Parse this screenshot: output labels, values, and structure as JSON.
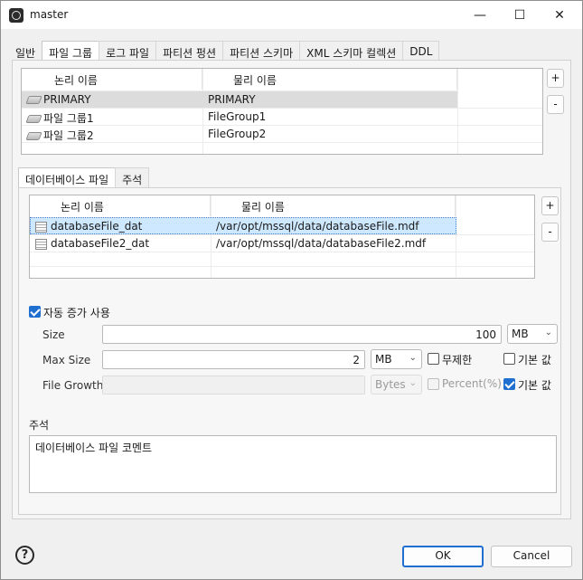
{
  "window": {
    "title": "master",
    "controls": {
      "minimize": "—",
      "maximize": "☐",
      "close": "✕"
    }
  },
  "tabs": [
    "일반",
    "파일 그룹",
    "로그 파일",
    "파티션 펑션",
    "파티션 스키마",
    "XML 스키마 컬렉션",
    "DDL"
  ],
  "active_tab": "파일 그룹",
  "filegroups": {
    "columns": [
      "논리 이름",
      "물리 이름"
    ],
    "rows": [
      {
        "logical": "PRIMARY",
        "physical": "PRIMARY",
        "selected": true
      },
      {
        "logical": "파일 그룹1",
        "physical": "FileGroup1",
        "selected": false
      },
      {
        "logical": "파일 그룹2",
        "physical": "FileGroup2",
        "selected": false
      }
    ],
    "add_label": "+",
    "remove_label": "-"
  },
  "subtabs": [
    "데이터베이스 파일",
    "주석"
  ],
  "active_subtab": "데이터베이스 파일",
  "dbfiles": {
    "columns": [
      "논리 이름",
      "물리 이름"
    ],
    "rows": [
      {
        "logical": "databaseFile_dat",
        "physical": "/var/opt/mssql/data/databaseFile.mdf",
        "selected": true
      },
      {
        "logical": "databaseFile2_dat",
        "physical": "/var/opt/mssql/data/databaseFile2.mdf",
        "selected": false
      }
    ],
    "add_label": "+",
    "remove_label": "-"
  },
  "autogrow": {
    "label": "자동 증가 사용",
    "checked": true,
    "size_label": "Size",
    "size_value": "100",
    "size_unit": "MB",
    "maxsize_label": "Max Size",
    "maxsize_value": "2",
    "maxsize_unit": "MB",
    "unlimited_label": "무제한",
    "unlimited_checked": false,
    "maxsize_default_label": "기본 값",
    "maxsize_default_checked": false,
    "filegrowth_label": "File Growth",
    "filegrowth_value": "",
    "filegrowth_unit": "Bytes",
    "percent_label": "Percent(%)",
    "percent_checked": false,
    "growth_default_label": "기본 값",
    "growth_default_checked": true
  },
  "comment": {
    "label": "주석",
    "value": "데이터베이스 파일 코멘트"
  },
  "footer": {
    "help_label": "?",
    "ok_label": "OK",
    "cancel_label": "Cancel"
  },
  "colors": {
    "accent": "#1f6fd1",
    "selection_blue": "#cde8ff",
    "selection_gray": "#dcdcdc"
  }
}
